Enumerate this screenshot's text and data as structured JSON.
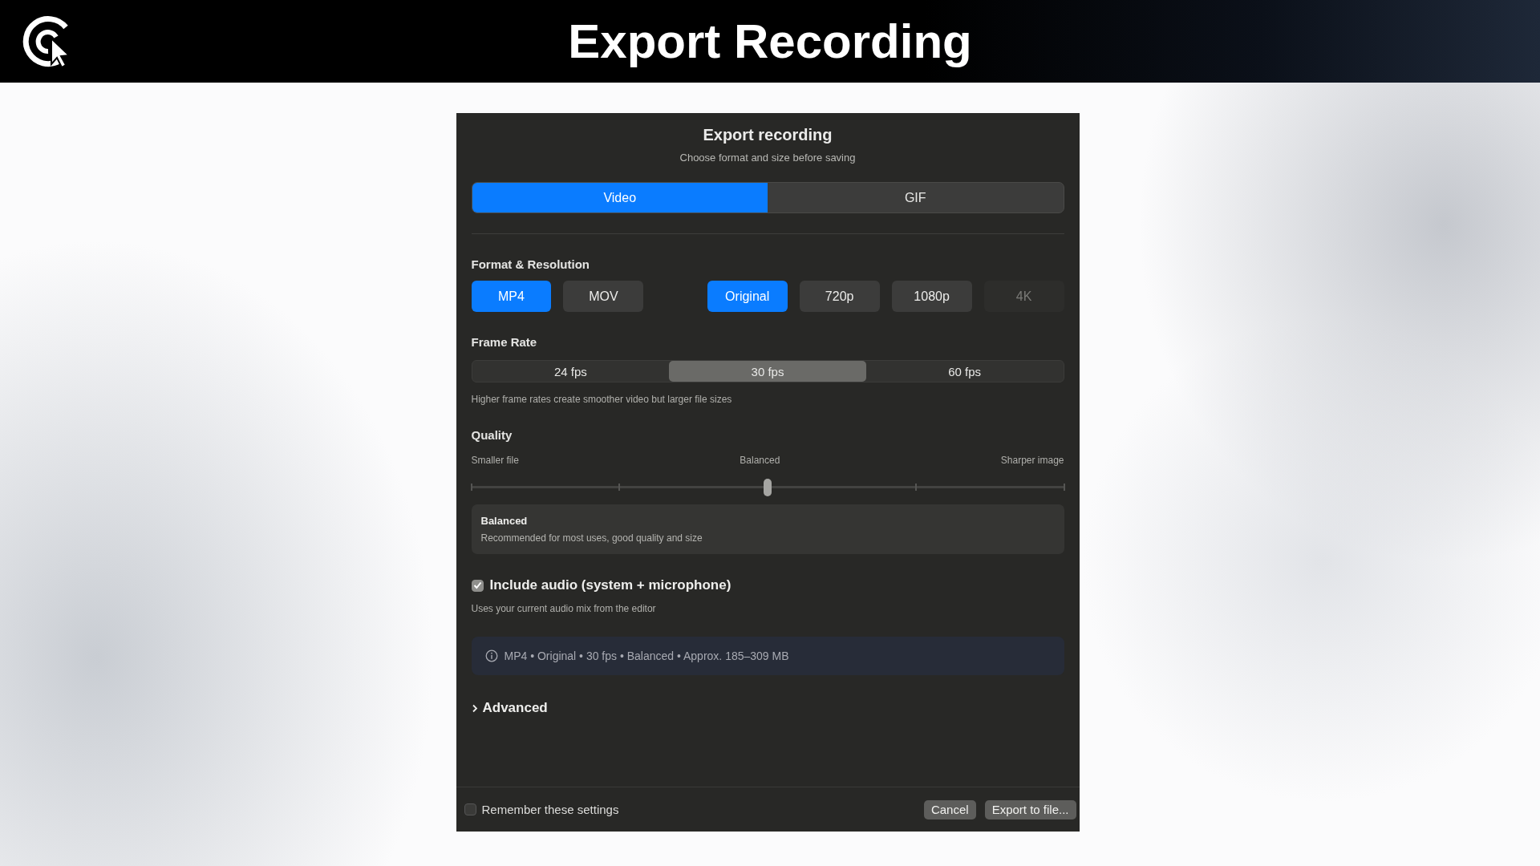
{
  "header": {
    "title": "Export Recording"
  },
  "dialog": {
    "title": "Export recording",
    "subtitle": "Choose format and size before saving",
    "tabs": [
      {
        "label": "Video",
        "selected": true
      },
      {
        "label": "GIF",
        "selected": false
      }
    ],
    "format_section": {
      "heading": "Format & Resolution",
      "formats": [
        {
          "label": "MP4",
          "selected": true
        },
        {
          "label": "MOV",
          "selected": false
        }
      ],
      "resolutions": [
        {
          "label": "Original",
          "selected": true,
          "disabled": false
        },
        {
          "label": "720p",
          "selected": false,
          "disabled": false
        },
        {
          "label": "1080p",
          "selected": false,
          "disabled": false
        },
        {
          "label": "4K",
          "selected": false,
          "disabled": true
        }
      ]
    },
    "frame_rate": {
      "heading": "Frame Rate",
      "options": [
        {
          "label": "24 fps",
          "selected": false
        },
        {
          "label": "30 fps",
          "selected": true
        },
        {
          "label": "60 fps",
          "selected": false
        }
      ],
      "hint": "Higher frame rates create smoother video but larger file sizes"
    },
    "quality": {
      "heading": "Quality",
      "scale_labels": [
        "Smaller file",
        "Balanced",
        "Sharper image"
      ],
      "level": 0.5,
      "summary_title": "Balanced",
      "summary_text": "Recommended for most uses, good quality and size"
    },
    "audio": {
      "label": "Include audio (system + microphone)",
      "checked": true,
      "hint": "Uses your current audio mix from the editor"
    },
    "summary": "MP4 • Original • 30 fps • Balanced • Approx. 185–309 MB",
    "advanced": {
      "label": "Advanced",
      "expanded": false
    },
    "footer": {
      "remember": {
        "label": "Remember these settings",
        "checked": false
      },
      "buttons": [
        {
          "label": "Cancel"
        },
        {
          "label": "Export to file..."
        }
      ]
    }
  }
}
